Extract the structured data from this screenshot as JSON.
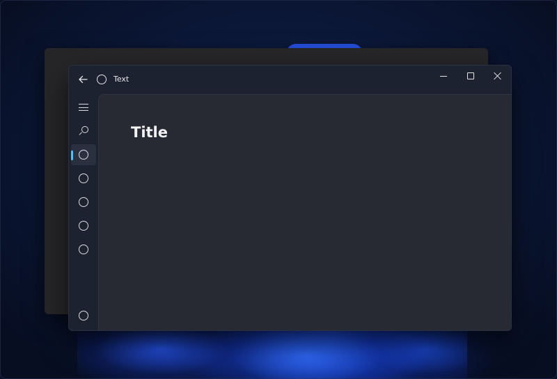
{
  "window": {
    "title": "Text",
    "back_icon": "arrow-left-icon",
    "app_icon": "circle-icon",
    "caption": {
      "minimize_icon": "minimize-icon",
      "maximize_icon": "maximize-icon",
      "close_icon": "close-icon"
    }
  },
  "navigation": {
    "menu_icon": "hamburger-icon",
    "search_icon": "search-icon",
    "items": [
      {
        "icon": "circle-icon",
        "selected": true
      },
      {
        "icon": "circle-icon",
        "selected": false
      },
      {
        "icon": "circle-icon",
        "selected": false
      },
      {
        "icon": "circle-icon",
        "selected": false
      },
      {
        "icon": "circle-icon",
        "selected": false
      }
    ],
    "footer_item": {
      "icon": "circle-icon"
    }
  },
  "content": {
    "title": "Title"
  },
  "colors": {
    "accent": "#4cc2ff",
    "window_bg": "#1d2230",
    "content_bg": "#272a33",
    "text": "#f2f2f5"
  }
}
